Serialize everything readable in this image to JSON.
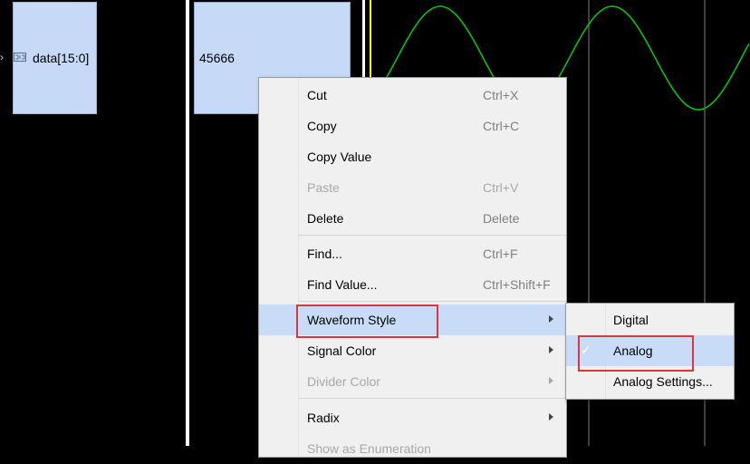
{
  "signal": {
    "name": "data[15:0]",
    "value": "45666",
    "expand_icon": "chevron-right-icon",
    "bus_icon": "bus-signal-icon"
  },
  "waveform": {
    "color": "#00d000",
    "cursor_color": "#ffff00",
    "grid_color": "#808080",
    "style": "Analog"
  },
  "context_menu": {
    "items": [
      {
        "label": "Cut",
        "shortcut": "Ctrl+X",
        "enabled": true
      },
      {
        "label": "Copy",
        "shortcut": "Ctrl+C",
        "enabled": true
      },
      {
        "label": "Copy Value",
        "shortcut": "",
        "enabled": true
      },
      {
        "label": "Paste",
        "shortcut": "Ctrl+V",
        "enabled": false
      },
      {
        "label": "Delete",
        "shortcut": "Delete",
        "enabled": true
      },
      {
        "label": "Find...",
        "shortcut": "Ctrl+F",
        "enabled": true
      },
      {
        "label": "Find Value...",
        "shortcut": "Ctrl+Shift+F",
        "enabled": true
      },
      {
        "label": "Waveform Style",
        "shortcut": "",
        "enabled": true,
        "submenu": true,
        "highlighted": true
      },
      {
        "label": "Signal Color",
        "shortcut": "",
        "enabled": true,
        "submenu": true
      },
      {
        "label": "Divider Color",
        "shortcut": "",
        "enabled": false,
        "submenu": true
      },
      {
        "label": "Radix",
        "shortcut": "",
        "enabled": true,
        "submenu": true
      },
      {
        "label": "Show as Enumeration",
        "shortcut": "",
        "enabled": false
      }
    ]
  },
  "waveform_style_submenu": {
    "items": [
      {
        "label": "Digital",
        "checked": false
      },
      {
        "label": "Analog",
        "checked": true,
        "highlighted": true
      },
      {
        "label": "Analog Settings...",
        "checked": false
      }
    ],
    "check_mark": "✓"
  },
  "highlight_color": "#d9363e"
}
